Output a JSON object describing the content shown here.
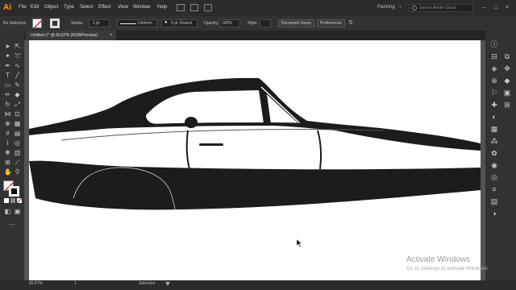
{
  "app": {
    "logo": "Ai"
  },
  "menu": {
    "items": [
      "File",
      "Edit",
      "Object",
      "Type",
      "Select",
      "Effect",
      "View",
      "Window",
      "Help"
    ]
  },
  "workspace": {
    "label": "Painting"
  },
  "search": {
    "placeholder": "Search Adobe Stock"
  },
  "control_bar": {
    "selection": "No Selection",
    "stroke_label": "Stroke:",
    "stroke_value": "1 pt",
    "profile": "Uniform",
    "brush": "5 pt. Round",
    "opacity_label": "Opacity:",
    "opacity_value": "100%",
    "style_label": "Style:",
    "doc_setup": "Document Setup",
    "preferences": "Preferences"
  },
  "document": {
    "tab_title": "Untitled-1* @ 66,67% (RGB/Preview)",
    "close": "×"
  },
  "status": {
    "zoom": "66,67%",
    "page": "1",
    "tool": "Selection"
  },
  "watermark": {
    "title": "Activate Windows",
    "subtitle": "Go to Settings to activate Windows."
  },
  "tools": [
    "selection-icon",
    "direct-selection-icon",
    "magic-wand-icon",
    "lasso-icon",
    "pen-icon",
    "curvature-icon",
    "type-icon",
    "line-icon",
    "rectangle-icon",
    "paintbrush-icon",
    "pencil-icon",
    "eraser-icon",
    "rotate-icon",
    "scale-icon",
    "width-icon",
    "free-transform-icon",
    "shape-builder-icon",
    "perspective-icon",
    "mesh-icon",
    "gradient-icon",
    "eyedropper-icon",
    "blend-icon",
    "symbol-icon",
    "graph-icon",
    "artboard-icon",
    "slice-icon",
    "hand-icon",
    "zoom-icon"
  ],
  "right_panel_icons": [
    "info-icon",
    "align-icon",
    "layers-icon",
    "properties-icon",
    "links-icon",
    "libraries-icon",
    "color-icon",
    "swatches-icon",
    "brushes-icon",
    "symbols-icon",
    "graphic-styles-icon",
    "appearance-icon",
    "stroke-icon",
    "gradient-panel-icon",
    "transparency-icon",
    "pathfinder-icon",
    "transform-icon",
    "artboards-icon",
    "asset-export-icon",
    "navigator-icon"
  ]
}
